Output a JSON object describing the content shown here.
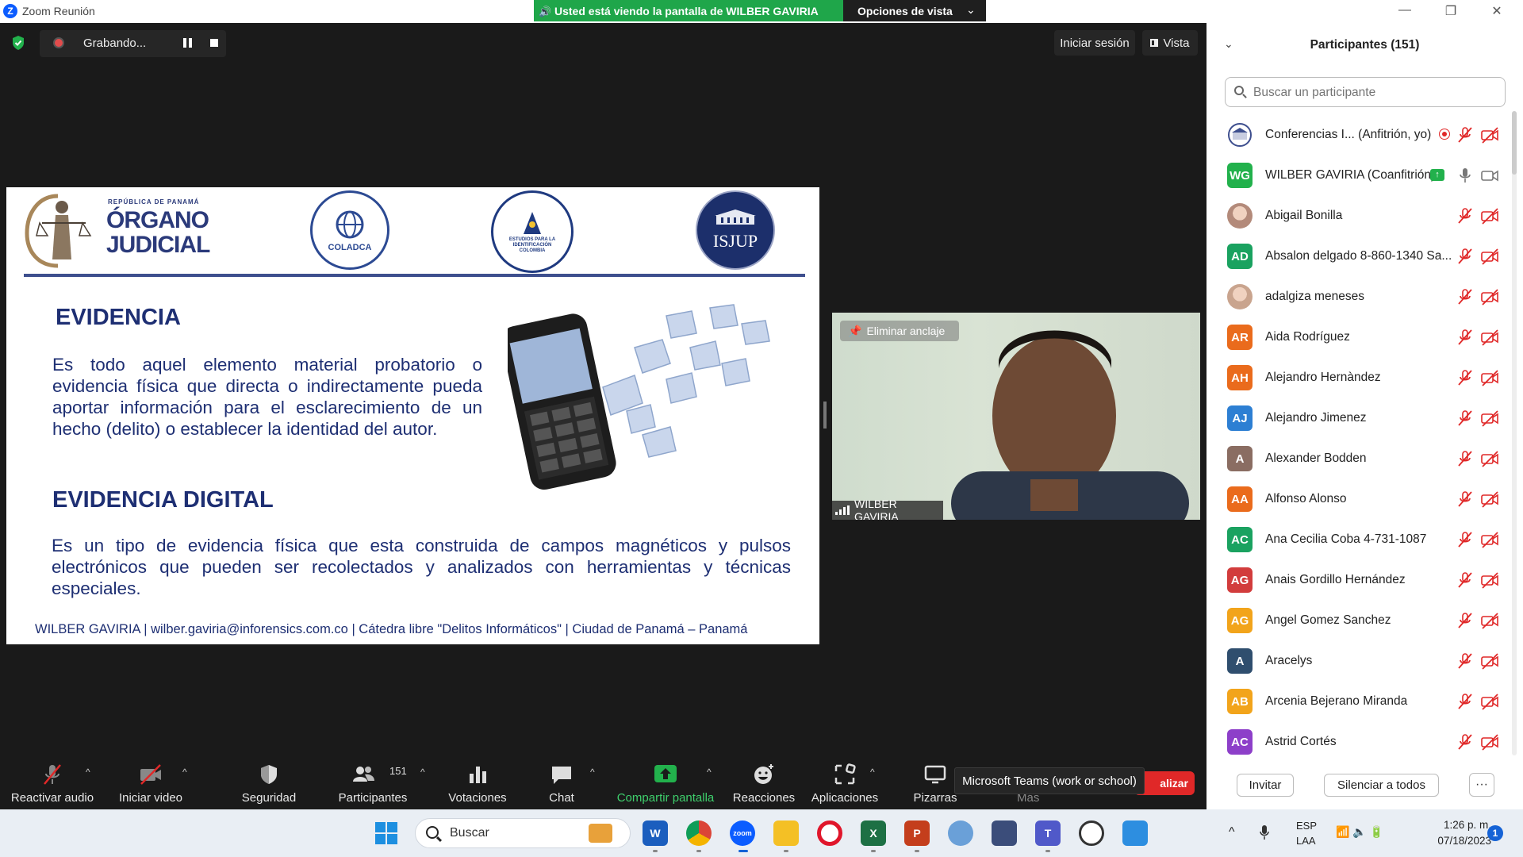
{
  "window": {
    "title": "Zoom Reunión",
    "app_logo_letter": "Z",
    "viewing_banner": "Usted está viendo la pantalla de WILBER GAVIRIA",
    "view_options": "Opciones de vista",
    "controls": [
      "—",
      "❐",
      "✕"
    ]
  },
  "top_bar": {
    "recording_label": "Grabando...",
    "sign_in": "Iniciar sesión",
    "view": "Vista"
  },
  "slide": {
    "judicial_small": "REPÚBLICA DE PANAMÁ",
    "judicial_line1": "ÓRGANO",
    "judicial_line2": "JUDICIAL",
    "seal_coladca": "COLADCA",
    "seal_asociacion": "ESTUDIOS PARA LA IDENTIFICACIÓN COLOMBIA",
    "seal_isjup": "ISJUP",
    "evidence_title": "EVIDENCIA",
    "evidence_text": "Es todo aquel elemento material probatorio o evidencia física que directa o indirectamente pueda aportar información para el esclarecimiento de un hecho (delito) o establecer la identidad del autor.",
    "digital_title": "EVIDENCIA DIGITAL",
    "digital_text": "Es un tipo de evidencia física que esta construida de campos magnéticos y pulsos electrónicos que pueden ser recolectados y analizados con herramientas y técnicas especiales.",
    "footer": "WILBER GAVIRIA |  wilber.gaviria@inforensics.com.co | Cátedra libre \"Delitos Informáticos\"  | Ciudad de Panamá – Panamá"
  },
  "video": {
    "unpin": "Eliminar anclaje",
    "name": "WILBER GAVIRIA"
  },
  "participants": {
    "title": "Participantes (151)",
    "search_placeholder": "Buscar un participante",
    "items": [
      {
        "initials": "",
        "name": "Conferencias I...  (Anfitrión, yo)",
        "color": "#ffffff",
        "mic": "muted",
        "cam": "off",
        "extra": "rec"
      },
      {
        "initials": "WG",
        "name": "WILBER GAVIRIA (Coanfitrión)",
        "color": "#22b14c",
        "mic": "on",
        "cam": "on",
        "extra": "share"
      },
      {
        "initials": "",
        "name": "Abigail Bonilla",
        "color": "#b38a7a",
        "mic": "muted",
        "cam": "off"
      },
      {
        "initials": "AD",
        "name": "Absalon delgado 8-860-1340  Sa...",
        "color": "#1aa260",
        "mic": "muted",
        "cam": "off"
      },
      {
        "initials": "",
        "name": "adalgiza meneses",
        "color": "#c9a48e",
        "mic": "muted",
        "cam": "off"
      },
      {
        "initials": "AR",
        "name": "Aida Rodríguez",
        "color": "#ea6b1c",
        "mic": "muted",
        "cam": "off"
      },
      {
        "initials": "AH",
        "name": "Alejandro Hernàndez",
        "color": "#ea6b1c",
        "mic": "muted",
        "cam": "off"
      },
      {
        "initials": "AJ",
        "name": "Alejandro Jimenez",
        "color": "#2d7fd3",
        "mic": "muted",
        "cam": "off"
      },
      {
        "initials": "A",
        "name": "Alexander Bodden",
        "color": "#8a6d62",
        "mic": "muted",
        "cam": "off"
      },
      {
        "initials": "AA",
        "name": "Alfonso Alonso",
        "color": "#ea6b1c",
        "mic": "muted",
        "cam": "off"
      },
      {
        "initials": "AC",
        "name": "Ana Cecilia Coba 4-731-1087",
        "color": "#1aa260",
        "mic": "muted",
        "cam": "off"
      },
      {
        "initials": "AG",
        "name": "Anais Gordillo Hernández",
        "color": "#d23c3c",
        "mic": "muted",
        "cam": "off"
      },
      {
        "initials": "AG",
        "name": "Angel Gomez Sanchez",
        "color": "#f2a41b",
        "mic": "muted",
        "cam": "off"
      },
      {
        "initials": "A",
        "name": "Aracelys",
        "color": "#2f4e6e",
        "mic": "muted",
        "cam": "off"
      },
      {
        "initials": "AB",
        "name": "Arcenia Bejerano Miranda",
        "color": "#f2a41b",
        "mic": "muted",
        "cam": "off"
      },
      {
        "initials": "AC",
        "name": "Astrid Cortés",
        "color": "#8d3fc9",
        "mic": "muted",
        "cam": "off"
      }
    ],
    "invite": "Invitar",
    "mute_all": "Silenciar a todos",
    "more": "···"
  },
  "toolbar": {
    "unmute": "Reactivar audio",
    "start_video": "Iniciar video",
    "security": "Seguridad",
    "participants": "Participantes",
    "participants_count": "151",
    "polls": "Votaciones",
    "chat": "Chat",
    "share": "Compartir pantalla",
    "reactions": "Reacciones",
    "apps": "Aplicaciones",
    "whiteboards": "Pizarras",
    "more": "Más",
    "end": "alizar",
    "tooltip": "Microsoft Teams (work or school)"
  },
  "taskbar": {
    "search": "Buscar",
    "lang1": "ESP",
    "lang2": "LAA",
    "time": "1:26 p. m.",
    "date": "07/18/2023",
    "notifications": "1"
  },
  "colors": {
    "zoom_blue": "#0b5cff",
    "banner_green": "#1fa64a",
    "share_green": "#22b14c",
    "muted_red": "#e02828",
    "slide_navy": "#1e2f73"
  }
}
